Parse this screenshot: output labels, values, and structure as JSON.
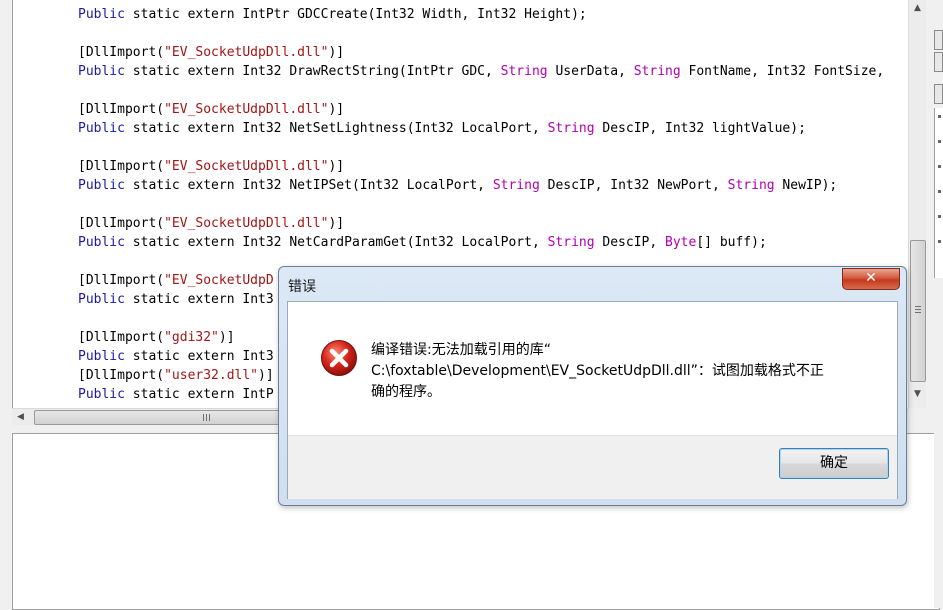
{
  "code": {
    "lines": [
      {
        "kw": "Public",
        "rest": " static extern IntPtr GDCCreate(Int32 Width, Int32 Height);"
      },
      {
        "attr_open": "[DllImport(",
        "str": "\"EV_SocketUdpDll.dll\"",
        "attr_close": ")]"
      },
      {
        "kw": "Public",
        "p1": " static extern Int32 DrawRectString(IntPtr GDC, ",
        "t1": "String",
        "p2": " UserData, ",
        "t2": "String",
        "p3": " FontName, Int32 FontSize,"
      },
      {
        "attr_open": "[DllImport(",
        "str": "\"EV_SocketUdpDll.dll\"",
        "attr_close": ")]"
      },
      {
        "kw": "Public",
        "p1": " static extern Int32 NetSetLightness(Int32 LocalPort, ",
        "t1": "String",
        "p2": " DescIP, Int32 lightValue);"
      },
      {
        "attr_open": "[DllImport(",
        "str": "\"EV_SocketUdpDll.dll\"",
        "attr_close": ")]"
      },
      {
        "kw": "Public",
        "p1": " static extern Int32 NetIPSet(Int32 LocalPort, ",
        "t1": "String",
        "p2": " DescIP, Int32 NewPort, ",
        "t2": "String",
        "p3": " NewIP);"
      },
      {
        "attr_open": "[DllImport(",
        "str": "\"EV_SocketUdpDll.dll\"",
        "attr_close": ")]"
      },
      {
        "kw": "Public",
        "p1": " static extern Int32 NetCardParamGet(Int32 LocalPort, ",
        "t1": "String",
        "p2": " DescIP, ",
        "t2": "Byte",
        "p3": "[] buff);"
      },
      {
        "attr_open": "[DllImport(",
        "str": "\"EV_SocketUdpD",
        "attr_close": ""
      },
      {
        "kw": "Public",
        "rest": " static extern Int3"
      },
      {
        "attr_open": "[DllImport(",
        "str": "\"gdi32\"",
        "attr_close": ")]"
      },
      {
        "kw": "Public",
        "rest": " static extern Int3"
      },
      {
        "attr_open": "[DllImport(",
        "str": "\"user32.dll\"",
        "attr_close": ")]"
      },
      {
        "kw": "Public",
        "rest": " static extern IntP"
      }
    ]
  },
  "dialog": {
    "title": "错误",
    "close_label": "✕",
    "message_lines": [
      "编译错误:无法加载引用的库“",
      "C:\\foxtable\\Development\\EV_SocketUdpDll.dll”：试图加载格式不正",
      "确的程序。"
    ],
    "ok_label": "确定",
    "icon": "error-icon"
  },
  "colors": {
    "keyword": "#1a1aa6",
    "type": "#b000b0",
    "string": "#a31515",
    "close_button": "#c33a1f",
    "ok_border": "#3c7fb1"
  }
}
